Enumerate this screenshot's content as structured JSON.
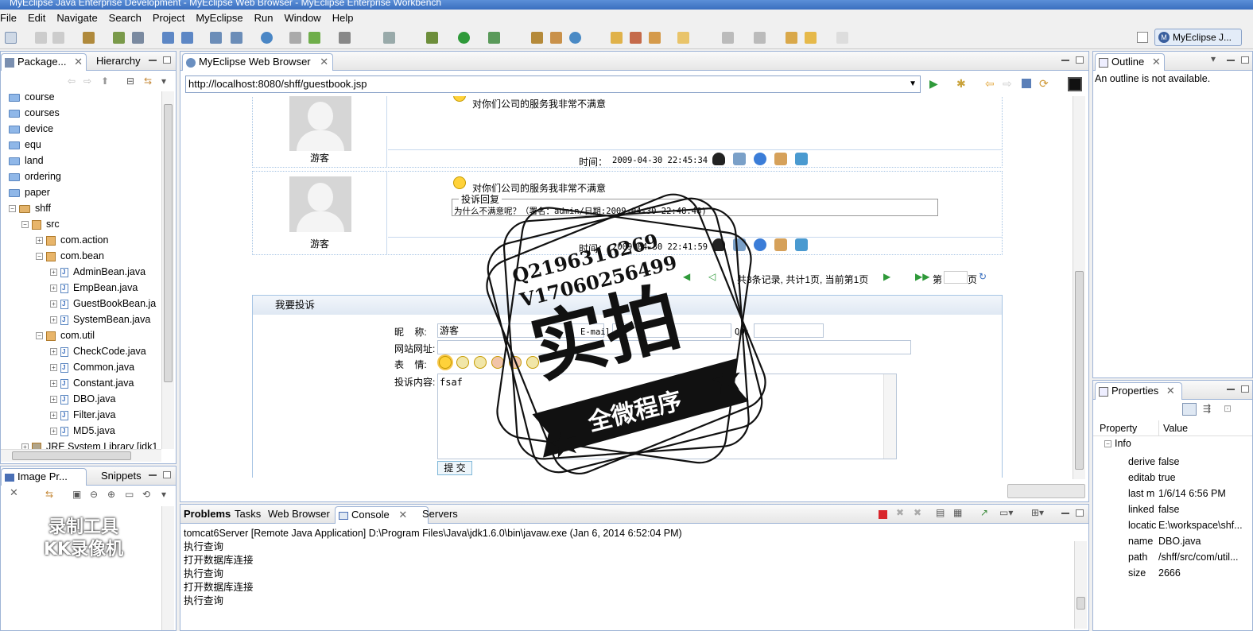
{
  "window": {
    "title": "MyEclipse Java Enterprise Development - MyEclipse Web Browser - MyEclipse Enterprise Workbench"
  },
  "menu": [
    "File",
    "Edit",
    "Navigate",
    "Search",
    "Project",
    "MyEclipse",
    "Run",
    "Window",
    "Help"
  ],
  "perspective": {
    "label": "MyEclipse J..."
  },
  "left_panel": {
    "tabs": [
      "Package...",
      "Hierarchy"
    ],
    "tree": [
      {
        "label": "course",
        "kind": "folder",
        "depth": 0
      },
      {
        "label": "courses",
        "kind": "folder",
        "depth": 0
      },
      {
        "label": "device",
        "kind": "folder",
        "depth": 0
      },
      {
        "label": "equ",
        "kind": "folder",
        "depth": 0
      },
      {
        "label": "land",
        "kind": "folder",
        "depth": 0
      },
      {
        "label": "ordering",
        "kind": "folder",
        "depth": 0
      },
      {
        "label": "paper",
        "kind": "folder",
        "depth": 0
      },
      {
        "label": "shff",
        "kind": "project",
        "depth": 0
      },
      {
        "label": "src",
        "kind": "src",
        "depth": 1
      },
      {
        "label": "com.action",
        "kind": "package",
        "depth": 2
      },
      {
        "label": "com.bean",
        "kind": "package",
        "depth": 2
      },
      {
        "label": "AdminBean.java",
        "kind": "java",
        "depth": 3
      },
      {
        "label": "EmpBean.java",
        "kind": "java",
        "depth": 3
      },
      {
        "label": "GuestBookBean.ja",
        "kind": "java",
        "depth": 3
      },
      {
        "label": "SystemBean.java",
        "kind": "java",
        "depth": 3
      },
      {
        "label": "com.util",
        "kind": "package",
        "depth": 2
      },
      {
        "label": "CheckCode.java",
        "kind": "java",
        "depth": 3
      },
      {
        "label": "Common.java",
        "kind": "java",
        "depth": 3
      },
      {
        "label": "Constant.java",
        "kind": "java",
        "depth": 3
      },
      {
        "label": "DBO.java",
        "kind": "java",
        "depth": 3
      },
      {
        "label": "Filter.java",
        "kind": "java",
        "depth": 3
      },
      {
        "label": "MD5.java",
        "kind": "java",
        "depth": 3
      },
      {
        "label": "JRE System Library [jdk1",
        "kind": "lib",
        "depth": 1
      }
    ]
  },
  "image_panel": {
    "tabs": [
      "Image Pr...",
      "Snippets"
    ]
  },
  "browser": {
    "tab_label": "MyEclipse Web Browser",
    "url": "http://localhost:8080/shff/guestbook.jsp",
    "posts": [
      {
        "author": "游客",
        "text": "对你们公司的服务我非常不满意",
        "time_label": "时间：",
        "time": "2009-04-30 22:45:34"
      },
      {
        "author": "游客",
        "text": "对你们公司的服务我非常不满意",
        "time_label": "时间：",
        "time": "2009-04-30 22:41:59",
        "reply_title": "投诉回复",
        "reply_text": "为什么不满意呢？（署名：admin/日期:2009-04-30 22:48:46)"
      }
    ],
    "pagination": {
      "summary": "共3条记录, 共计1页, 当前第1页",
      "page_prefix": "第",
      "page_suffix": "页"
    },
    "form": {
      "title": "我要投诉",
      "nickname_label": "昵    称:",
      "nickname_value": "游客",
      "email_label": "E-mail:",
      "qq_label": "QQ:",
      "url_label": "网站网址:",
      "mood_label": "表    情:",
      "content_label": "投诉内容:",
      "content_value": "fsaf",
      "submit_label": "提 交"
    }
  },
  "outline": {
    "tab_label": "Outline",
    "message": "An outline is not available."
  },
  "properties": {
    "tab_label": "Properties",
    "col_property": "Property",
    "col_value": "Value",
    "group": "Info",
    "rows": [
      {
        "key": "derive",
        "value": "false"
      },
      {
        "key": "editab",
        "value": "true"
      },
      {
        "key": "last m",
        "value": "1/6/14 6:56 PM"
      },
      {
        "key": "linked",
        "value": "false"
      },
      {
        "key": "locatic",
        "value": "E:\\workspace\\shf..."
      },
      {
        "key": "name",
        "value": "DBO.java"
      },
      {
        "key": "path",
        "value": "/shff/src/com/util..."
      },
      {
        "key": "size",
        "value": "2666"
      }
    ]
  },
  "bottom": {
    "tabs": [
      "Problems",
      "Tasks",
      "Web Browser",
      "Console",
      "Servers"
    ],
    "console_header": "tomcat6Server [Remote Java Application] D:\\Program Files\\Java\\jdk1.6.0\\bin\\javaw.exe (Jan 6, 2014 6:52:04 PM)",
    "console_lines": [
      "执行查询",
      "打开数据库连接",
      "执行查询",
      "打开数据库连接",
      "执行查询"
    ]
  },
  "watermark": {
    "line1": "Q2196316269",
    "line2": "V17060256499",
    "big": "实拍",
    "banner": "全微程序",
    "kk_line1": "录制工具",
    "kk_line2": "KK录像机"
  }
}
